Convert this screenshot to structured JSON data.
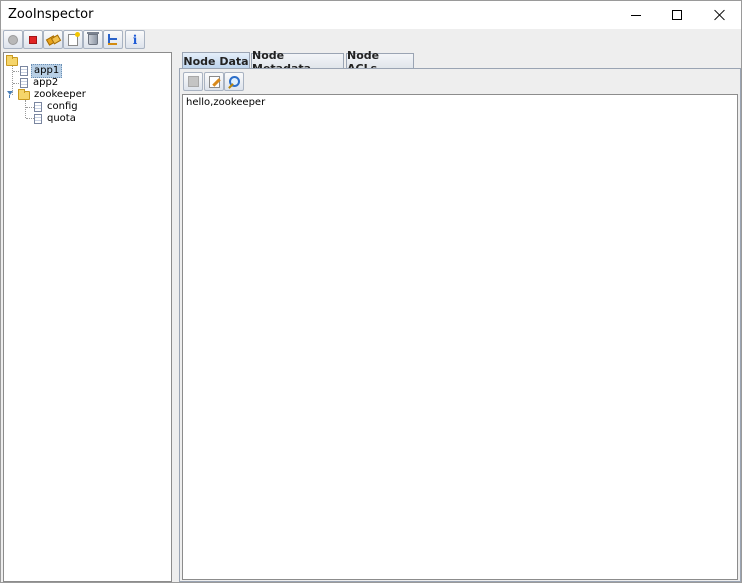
{
  "window": {
    "title": "ZooInspector"
  },
  "toolbar": {
    "buttons": [
      {
        "name": "disconnect",
        "icon": "gray-circle-icon"
      },
      {
        "name": "stop",
        "icon": "red-stop-icon"
      },
      {
        "name": "connect",
        "icon": "connect-plug-icon"
      },
      {
        "name": "add-node",
        "icon": "new-document-icon"
      },
      {
        "name": "delete-node",
        "icon": "trash-icon"
      },
      {
        "name": "refresh-tree",
        "icon": "tree-icon"
      },
      {
        "name": "about",
        "icon": "info-icon",
        "glyph": "i"
      }
    ]
  },
  "tree": {
    "nodes": [
      {
        "label": "app1",
        "selected": true
      },
      {
        "label": "app2"
      },
      {
        "label": "zookeeper",
        "children": [
          {
            "label": "config"
          },
          {
            "label": "quota"
          }
        ]
      }
    ]
  },
  "tabs": [
    {
      "label": "Node Data",
      "active": true
    },
    {
      "label": "Node Metadata"
    },
    {
      "label": "Node ACLs"
    }
  ],
  "node_data": {
    "content": "hello,zookeeper"
  }
}
